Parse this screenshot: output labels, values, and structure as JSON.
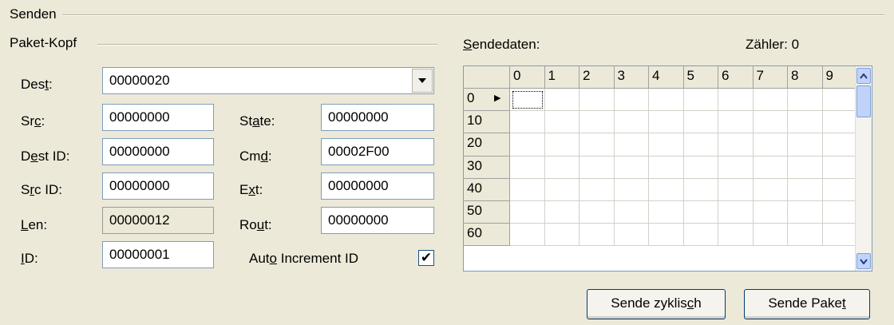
{
  "group_senden": {
    "title": "Senden"
  },
  "group_paketkopf": {
    "title": "Paket-Kopf"
  },
  "fields": {
    "dest": {
      "label_pre": "Des",
      "label_key": "t",
      "label_post": ":",
      "value": "00000020"
    },
    "src": {
      "label_pre": "Sr",
      "label_key": "c",
      "label_post": ":",
      "value": "00000000"
    },
    "dest_id": {
      "label_pre": "D",
      "label_key": "e",
      "label_post": "st ID:",
      "value": "00000000"
    },
    "src_id": {
      "label_pre": "S",
      "label_key": "r",
      "label_post": "c ID:",
      "value": "00000000"
    },
    "len": {
      "label_pre": "",
      "label_key": "L",
      "label_post": "en:",
      "value": "00000012"
    },
    "id": {
      "label_pre": "",
      "label_key": "I",
      "label_post": "D:",
      "value": "00000001"
    },
    "state": {
      "label_pre": "St",
      "label_key": "a",
      "label_post": "te:",
      "value": "00000000"
    },
    "cmd": {
      "label_pre": "Cm",
      "label_key": "d",
      "label_post": ":",
      "value": "00002F00"
    },
    "ext": {
      "label_pre": "E",
      "label_key": "x",
      "label_post": "t:",
      "value": "00000000"
    },
    "rout": {
      "label_pre": "Ro",
      "label_key": "u",
      "label_post": "t:",
      "value": "00000000"
    }
  },
  "auto_increment": {
    "label_pre": "Aut",
    "label_key": "o",
    "label_post": " Increment ID",
    "checked": true,
    "mark": "✔"
  },
  "sendedaten": {
    "label_key": "S",
    "label_post": "endedaten:"
  },
  "zaehler": {
    "label": "Zähler: 0"
  },
  "grid": {
    "columns": [
      "0",
      "1",
      "2",
      "3",
      "4",
      "5",
      "6",
      "7",
      "8",
      "9"
    ],
    "rows": [
      "0",
      "10",
      "20",
      "30",
      "40",
      "50",
      "60"
    ],
    "current_row_marker": "▶"
  },
  "buttons": {
    "zyklisch": {
      "pre": "Sende zyklis",
      "key": "c",
      "post": "h"
    },
    "paket": {
      "pre": "Sende Pake",
      "key": "t",
      "post": ""
    }
  },
  "icons": {
    "dropdown": "chevron-down-icon",
    "scroll_up": "scroll-up-icon",
    "scroll_down": "scroll-down-icon"
  },
  "colors": {
    "window_bg": "#ece9d8",
    "field_border": "#7f9db9",
    "scroll_blue": "#c1d3fb"
  }
}
